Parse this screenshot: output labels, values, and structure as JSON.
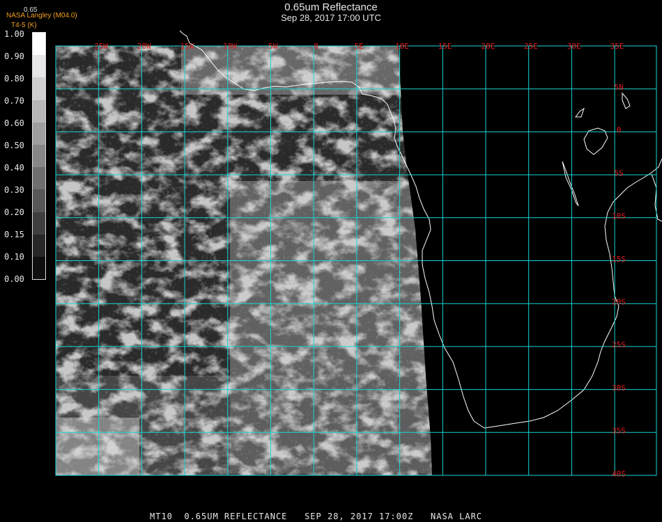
{
  "header": {
    "title": "0.65um Reflectance",
    "datetime": "Sep 28, 2017 17:00 UTC"
  },
  "credits": {
    "line1": "NASA Langley (M04.0)",
    "line2": "T4-5 (K)"
  },
  "colorbar": {
    "top_label": "0.65",
    "ticks": [
      "1.00",
      "0.90",
      "0.80",
      "0.70",
      "0.60",
      "0.50",
      "0.40",
      "0.30",
      "0.20",
      "0.15",
      "0.10",
      "0.00"
    ]
  },
  "map": {
    "grid_color": "#19d6d6",
    "label_color": "#e01c1c",
    "longitude_labels": [
      "25W",
      "20W",
      "15W",
      "10W",
      "5W",
      "0",
      "5E",
      "10E",
      "15E",
      "20E",
      "25E",
      "30E",
      "35E"
    ],
    "latitude_labels": [
      "5N",
      "0",
      "5S",
      "10S",
      "15S",
      "20S",
      "25S",
      "30S",
      "35S",
      "40S"
    ]
  },
  "footer": {
    "text": "MT10  0.65UM REFLECTANCE   SEP 28, 2017 17:00Z   NASA LARC"
  }
}
